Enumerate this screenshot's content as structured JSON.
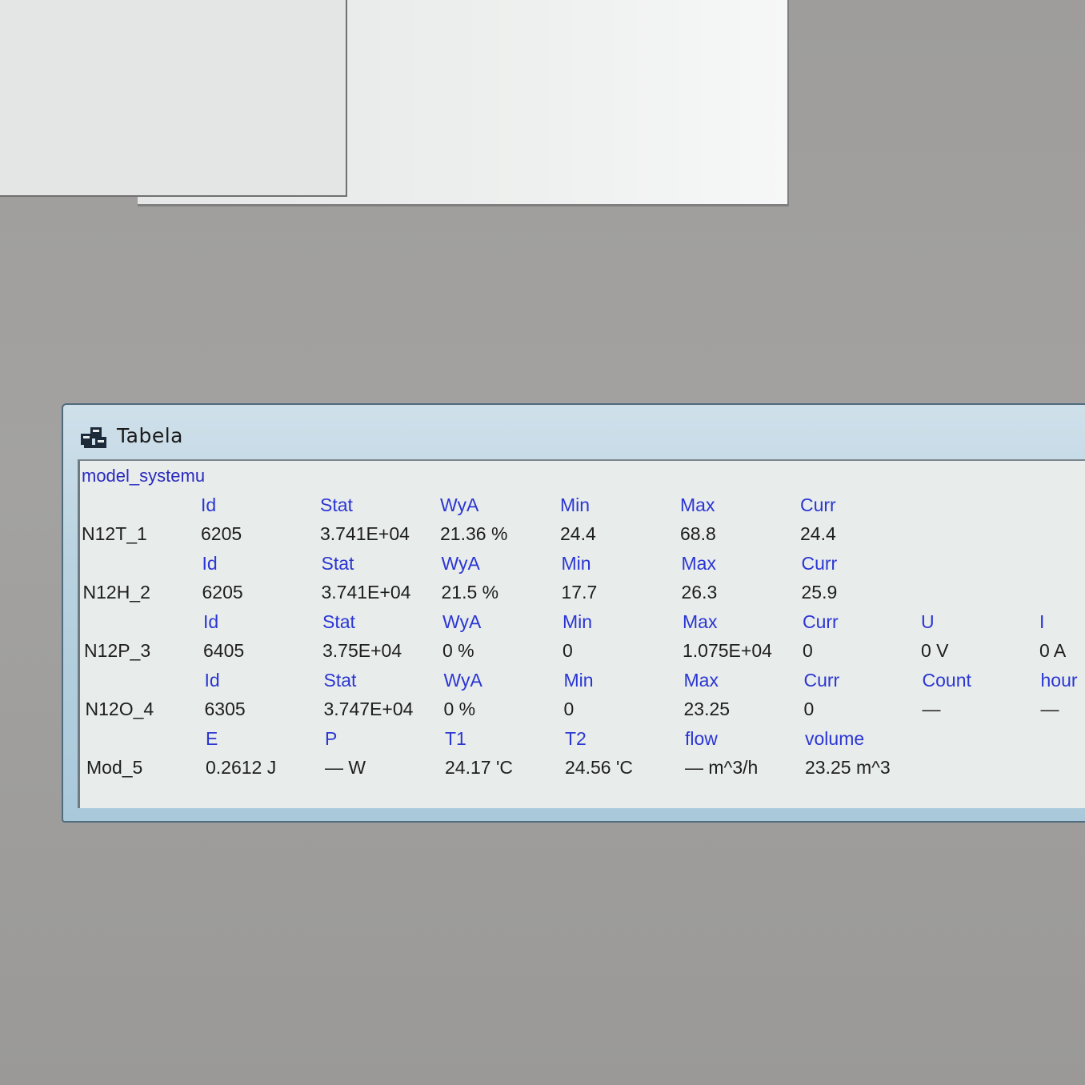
{
  "window": {
    "title": "Tabela",
    "section": "model_systemu"
  },
  "rows": [
    {
      "headers": [
        "Id",
        "Stat",
        "WyA",
        "Min",
        "Max",
        "Curr"
      ],
      "name": "N12T_1",
      "values": [
        "6205",
        "3.741E+04",
        "21.36 %",
        "24.4",
        "68.8",
        "24.4"
      ]
    },
    {
      "headers": [
        "Id",
        "Stat",
        "WyA",
        "Min",
        "Max",
        "Curr"
      ],
      "name": "N12H_2",
      "values": [
        "6205",
        "3.741E+04",
        "21.5 %",
        "17.7",
        "26.3",
        "25.9"
      ]
    },
    {
      "headers": [
        "Id",
        "Stat",
        "WyA",
        "Min",
        "Max",
        "Curr",
        "U",
        "I"
      ],
      "name": "N12P_3",
      "values": [
        "6405",
        "3.75E+04",
        "0 %",
        "0",
        "1.075E+04",
        "0",
        "0 V",
        "0 A"
      ]
    },
    {
      "headers": [
        "Id",
        "Stat",
        "WyA",
        "Min",
        "Max",
        "Curr",
        "Count",
        "hour"
      ],
      "name": "N12O_4",
      "values": [
        "6305",
        "3.747E+04",
        "0 %",
        "0",
        "23.25",
        "0",
        "—",
        "—"
      ]
    },
    {
      "headers": [
        "E",
        "P",
        "T1",
        "T2",
        "flow",
        "volume"
      ],
      "name": "Mod_5",
      "values": [
        "0.2612 J",
        "— W",
        "24.17 'C",
        "24.56 'C",
        "— m^3/h",
        "23.25 m^3"
      ]
    }
  ]
}
